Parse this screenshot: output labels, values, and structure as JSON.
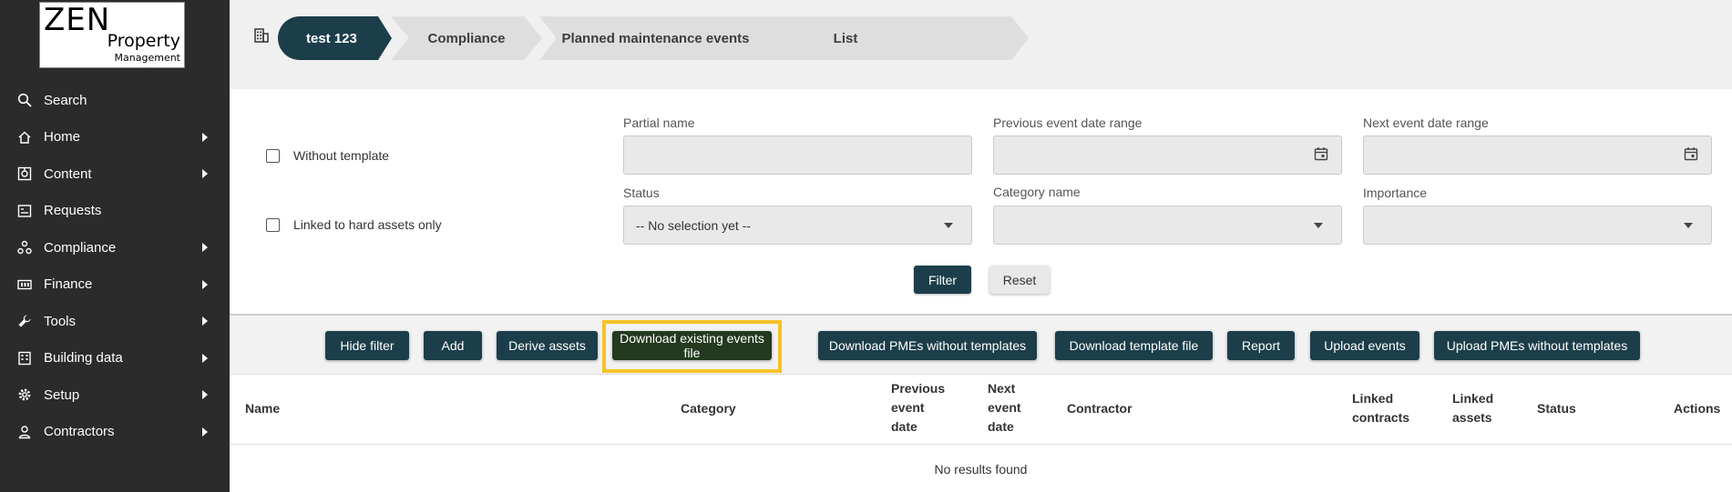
{
  "logo": {
    "line1": "ZEN",
    "line2": "Property",
    "line3": "Management"
  },
  "sidebar": {
    "items": [
      {
        "label": "Search",
        "icon": "search-icon",
        "has_arrow": false
      },
      {
        "label": "Home",
        "icon": "home-icon",
        "has_arrow": true
      },
      {
        "label": "Content",
        "icon": "content-icon",
        "has_arrow": true
      },
      {
        "label": "Requests",
        "icon": "requests-icon",
        "has_arrow": false
      },
      {
        "label": "Compliance",
        "icon": "compliance-icon",
        "has_arrow": true
      },
      {
        "label": "Finance",
        "icon": "finance-icon",
        "has_arrow": true
      },
      {
        "label": "Tools",
        "icon": "wrench-icon",
        "has_arrow": true
      },
      {
        "label": "Building data",
        "icon": "building-icon",
        "has_arrow": true
      },
      {
        "label": "Setup",
        "icon": "gear-icon",
        "has_arrow": true
      },
      {
        "label": "Contractors",
        "icon": "person-icon",
        "has_arrow": true
      }
    ]
  },
  "breadcrumb": [
    "test 123",
    "Compliance",
    "Planned maintenance events",
    "List"
  ],
  "filters": {
    "without_template": "Without template",
    "linked_hard_assets": "Linked to hard assets only",
    "partial_name": {
      "label": "Partial name",
      "value": ""
    },
    "previous_event_date_range": {
      "label": "Previous event date range",
      "value": ""
    },
    "next_event_date_range": {
      "label": "Next event date range",
      "value": ""
    },
    "status": {
      "label": "Status",
      "value": "-- No selection yet --"
    },
    "category_name": {
      "label": "Category name",
      "value": ""
    },
    "importance": {
      "label": "Importance",
      "value": ""
    },
    "filter_button": "Filter",
    "reset_button": "Reset"
  },
  "actions": {
    "hide_filter": "Hide filter",
    "add": "Add",
    "derive_assets": "Derive assets",
    "download_existing_events_file": "Download existing events file",
    "download_pmes_without_templates": "Download PMEs without templates",
    "download_template_file": "Download template file",
    "report": "Report",
    "upload_events": "Upload events",
    "upload_pmes_without_templates": "Upload PMEs without templates"
  },
  "table": {
    "columns": {
      "name": "Name",
      "category": "Category",
      "previous_event_date": [
        "Previous",
        "event",
        "date"
      ],
      "next_event_date": [
        "Next",
        "event",
        "date"
      ],
      "contractor": "Contractor",
      "linked_contracts": [
        "Linked",
        "contracts"
      ],
      "linked_assets": [
        "Linked",
        "assets"
      ],
      "status": "Status",
      "actions": "Actions"
    },
    "empty_message": "No results found"
  },
  "colors": {
    "sidebar": "#2b2b2b",
    "primary": "#1c3e4a",
    "highlight": "#f5c228",
    "breadcrumb_grey": "#dedede"
  }
}
